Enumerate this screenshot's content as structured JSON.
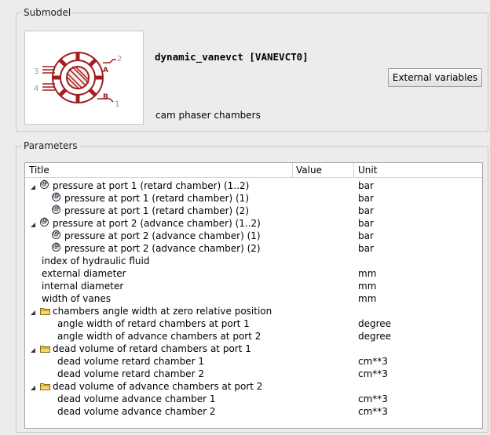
{
  "submodel": {
    "group_title": "Submodel",
    "name": "dynamic_vanevct [VANEVCT0]",
    "description": "cam phaser chambers",
    "external_button": "External variables",
    "thumbnail_ports": {
      "p1": "1",
      "p2": "2",
      "p3": "3",
      "p4": "4",
      "pa": "A",
      "pb": "B"
    }
  },
  "parameters": {
    "group_title": "Parameters",
    "columns": {
      "title": "Title",
      "value": "Value",
      "unit": "Unit"
    },
    "rows": [
      {
        "title": "pressure at port 1 (retard chamber) (1..2)",
        "value": "",
        "unit": "bar"
      },
      {
        "title": "pressure at port 1 (retard chamber) (1)",
        "value": "",
        "unit": "bar"
      },
      {
        "title": "pressure at port 1 (retard chamber) (2)",
        "value": "",
        "unit": "bar"
      },
      {
        "title": "pressure at port 2 (advance chamber) (1..2)",
        "value": "",
        "unit": "bar"
      },
      {
        "title": "pressure at port 2 (advance chamber) (1)",
        "value": "",
        "unit": "bar"
      },
      {
        "title": "pressure at port 2 (advance chamber) (2)",
        "value": "",
        "unit": "bar"
      },
      {
        "title": "index of hydraulic fluid",
        "value": "",
        "unit": ""
      },
      {
        "title": "external diameter",
        "value": "",
        "unit": "mm"
      },
      {
        "title": "internal diameter",
        "value": "",
        "unit": "mm"
      },
      {
        "title": "width of vanes",
        "value": "",
        "unit": "mm"
      },
      {
        "title": "chambers angle width at zero relative position",
        "value": "",
        "unit": ""
      },
      {
        "title": "angle width of retard chambers at port 1",
        "value": "",
        "unit": "degree"
      },
      {
        "title": "angle width of advance chambers at port 2",
        "value": "",
        "unit": "degree"
      },
      {
        "title": "dead volume of retard chambers at port 1",
        "value": "",
        "unit": ""
      },
      {
        "title": "dead volume retard chamber 1",
        "value": "",
        "unit": "cm**3"
      },
      {
        "title": "dead volume retard chamber 2",
        "value": "",
        "unit": "cm**3"
      },
      {
        "title": "dead volume of advance chambers at port 2",
        "value": "",
        "unit": ""
      },
      {
        "title": "dead volume advance chamber 1",
        "value": "",
        "unit": "cm**3"
      },
      {
        "title": "dead volume advance chamber 2",
        "value": "",
        "unit": "cm**3"
      }
    ]
  },
  "colors": {
    "icon_red": "#a01f1f",
    "folder_yellow": "#e8c84a",
    "background": "#ececec"
  }
}
